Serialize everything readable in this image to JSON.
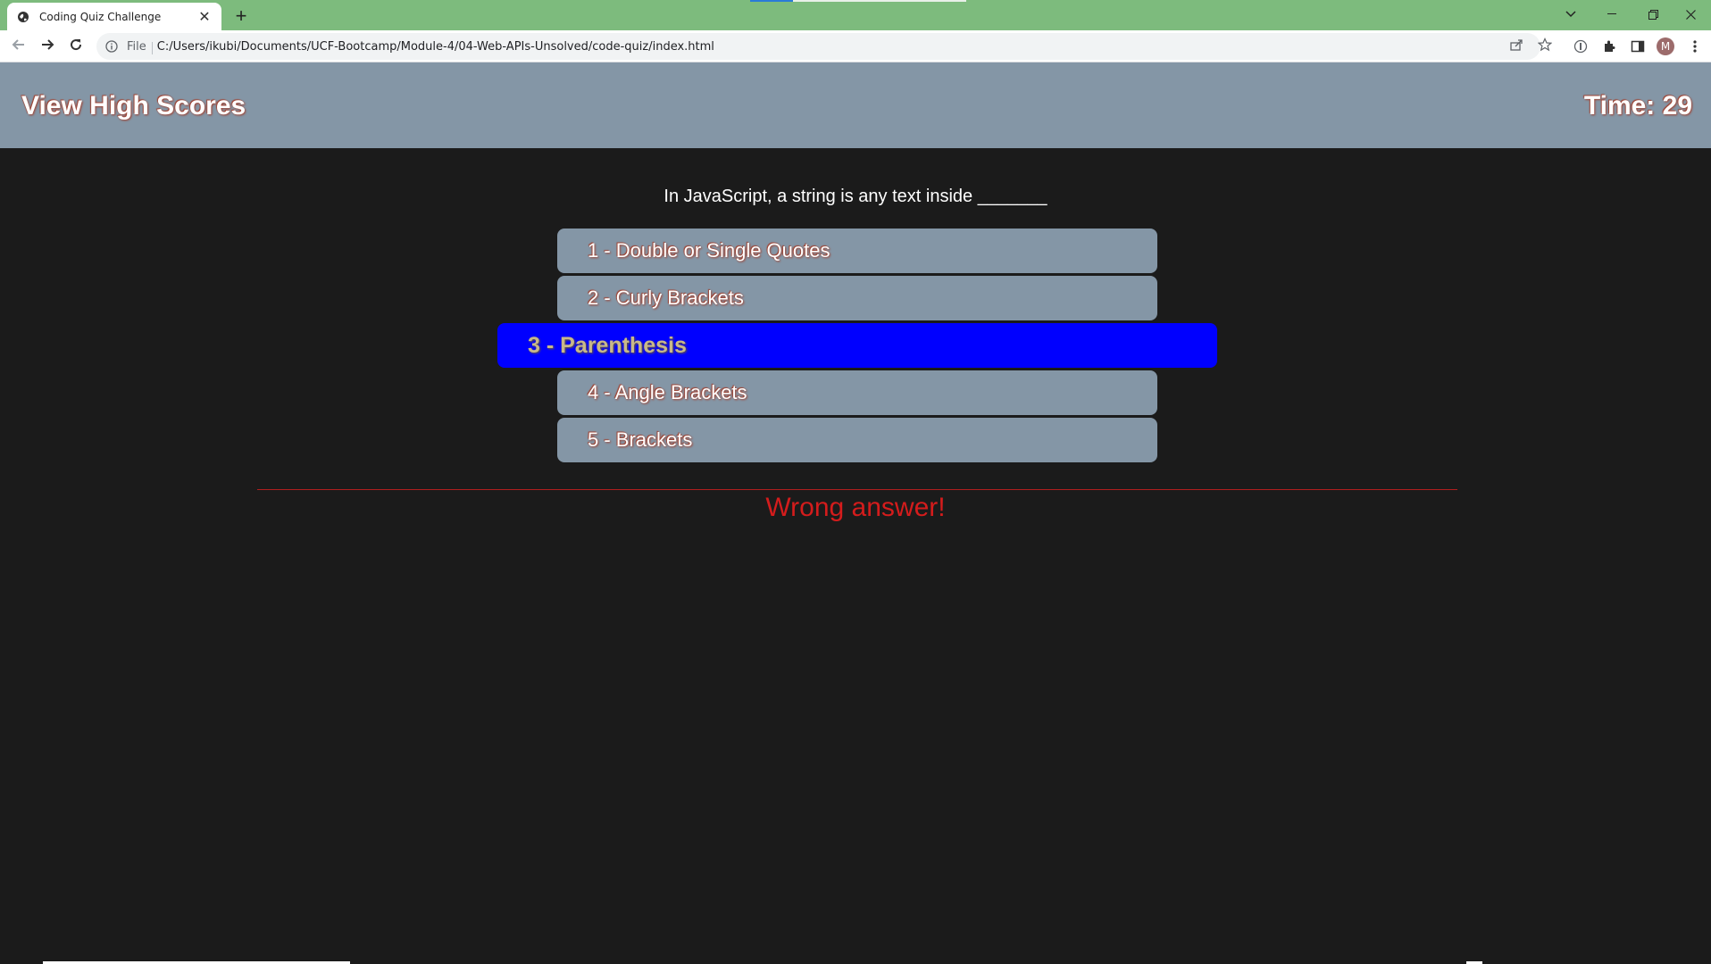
{
  "browser": {
    "tab_title": "Coding Quiz Challenge",
    "new_tab_icon": "plus-icon",
    "omnibox_scheme": "File",
    "url": "C:/Users/ikubi/Documents/UCF-Bootcamp/Module-4/04-Web-APIs-Unsolved/code-quiz/index.html",
    "profile_initial": "M"
  },
  "header": {
    "high_scores_label": "View High Scores",
    "timer_text": "Time: 29"
  },
  "quiz": {
    "question": "In JavaScript, a string is any text inside _______",
    "answers": [
      "1 - Double or Single Quotes",
      "2 - Curly Brackets",
      "3 - Parenthesis",
      "4 - Angle Brackets",
      "5 - Brackets"
    ],
    "selected_index": 2,
    "feedback": "Wrong answer!"
  },
  "colors": {
    "tabbar": "#7dbb7d",
    "header_bg": "#8496a6",
    "page_bg": "#1b1b1b",
    "selected_answer_bg": "#0000ff",
    "feedback_red": "#d41c1c"
  }
}
